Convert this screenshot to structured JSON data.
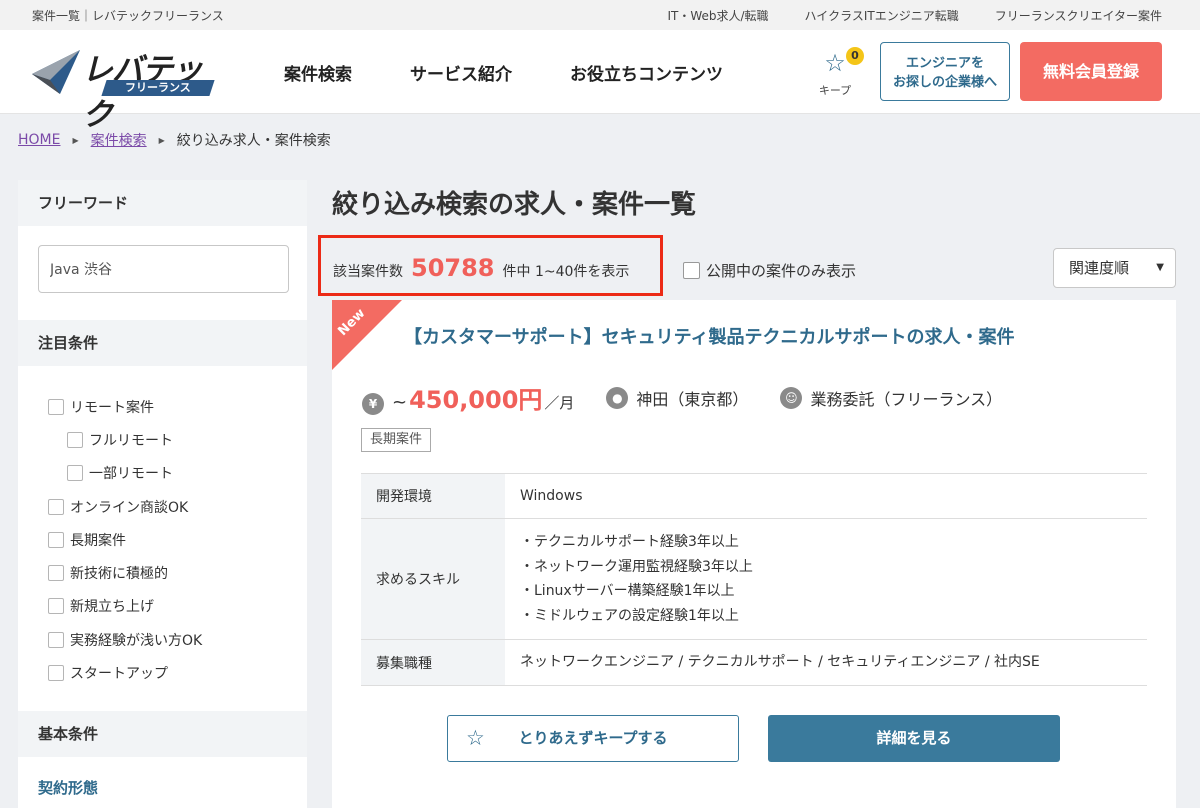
{
  "topbar": {
    "left": "案件一覧｜レバテックフリーランス",
    "links": [
      "IT・Web求人/転職",
      "ハイクラスITエンジニア転職",
      "フリーランスクリエイター案件"
    ]
  },
  "header": {
    "logo_brand": "レバテック",
    "logo_tag": "フリーランス",
    "nav": [
      "案件検索",
      "サービス紹介",
      "お役立ちコンテンツ"
    ],
    "keep_count": "0",
    "keep_label": "キープ",
    "corp_line1": "エンジニアを",
    "corp_line2": "お探しの企業様へ",
    "register": "無料会員登録"
  },
  "breadcrumb": {
    "home": "HOME",
    "search": "案件検索",
    "current": "絞り込み求人・案件検索"
  },
  "sidebar": {
    "freeword_heading": "フリーワード",
    "freeword_value": "Java 渋谷",
    "featured_heading": "注目条件",
    "checkboxes": [
      {
        "label": "リモート案件",
        "sub": false
      },
      {
        "label": "フルリモート",
        "sub": true
      },
      {
        "label": "一部リモート",
        "sub": true
      },
      {
        "label": "オンライン商談OK",
        "sub": false
      },
      {
        "label": "長期案件",
        "sub": false
      },
      {
        "label": "新技術に積極的",
        "sub": false
      },
      {
        "label": "新規立ち上げ",
        "sub": false
      },
      {
        "label": "実務経験が浅い方OK",
        "sub": false
      },
      {
        "label": "スタートアップ",
        "sub": false
      }
    ],
    "basic_heading": "基本条件",
    "contract_heading": "契約形態"
  },
  "main": {
    "title": "絞り込み検索の求人・案件一覧",
    "count_prefix": "該当案件数",
    "count_number": "50788",
    "count_suffix": "件中 1~40件を表示",
    "public_only": "公開中の案件のみ表示",
    "sort_selected": "関連度順"
  },
  "job": {
    "new_label": "New",
    "title": "【カスタマーサポート】セキュリティ製品テクニカルサポートの求人・案件",
    "salary_prefix": "~",
    "salary_amount": "450,000円",
    "salary_unit": "／月",
    "location": "神田（東京都）",
    "employment": "業務委託（フリーランス）",
    "badge": "長期案件",
    "env_label": "開発環境",
    "env_value": "Windows",
    "skills_label": "求めるスキル",
    "skills": [
      "・テクニカルサポート経験3年以上",
      "・ネットワーク運用監視経験3年以上",
      "・Linuxサーバー構築経験1年以上",
      "・ミドルウェアの設定経験1年以上"
    ],
    "role_label": "募集職種",
    "role_value": "ネットワークエンジニア / テクニカルサポート / セキュリティエンジニア / 社内SE",
    "keep_button": "とりあえずキープする",
    "detail_button": "詳細を見る"
  }
}
